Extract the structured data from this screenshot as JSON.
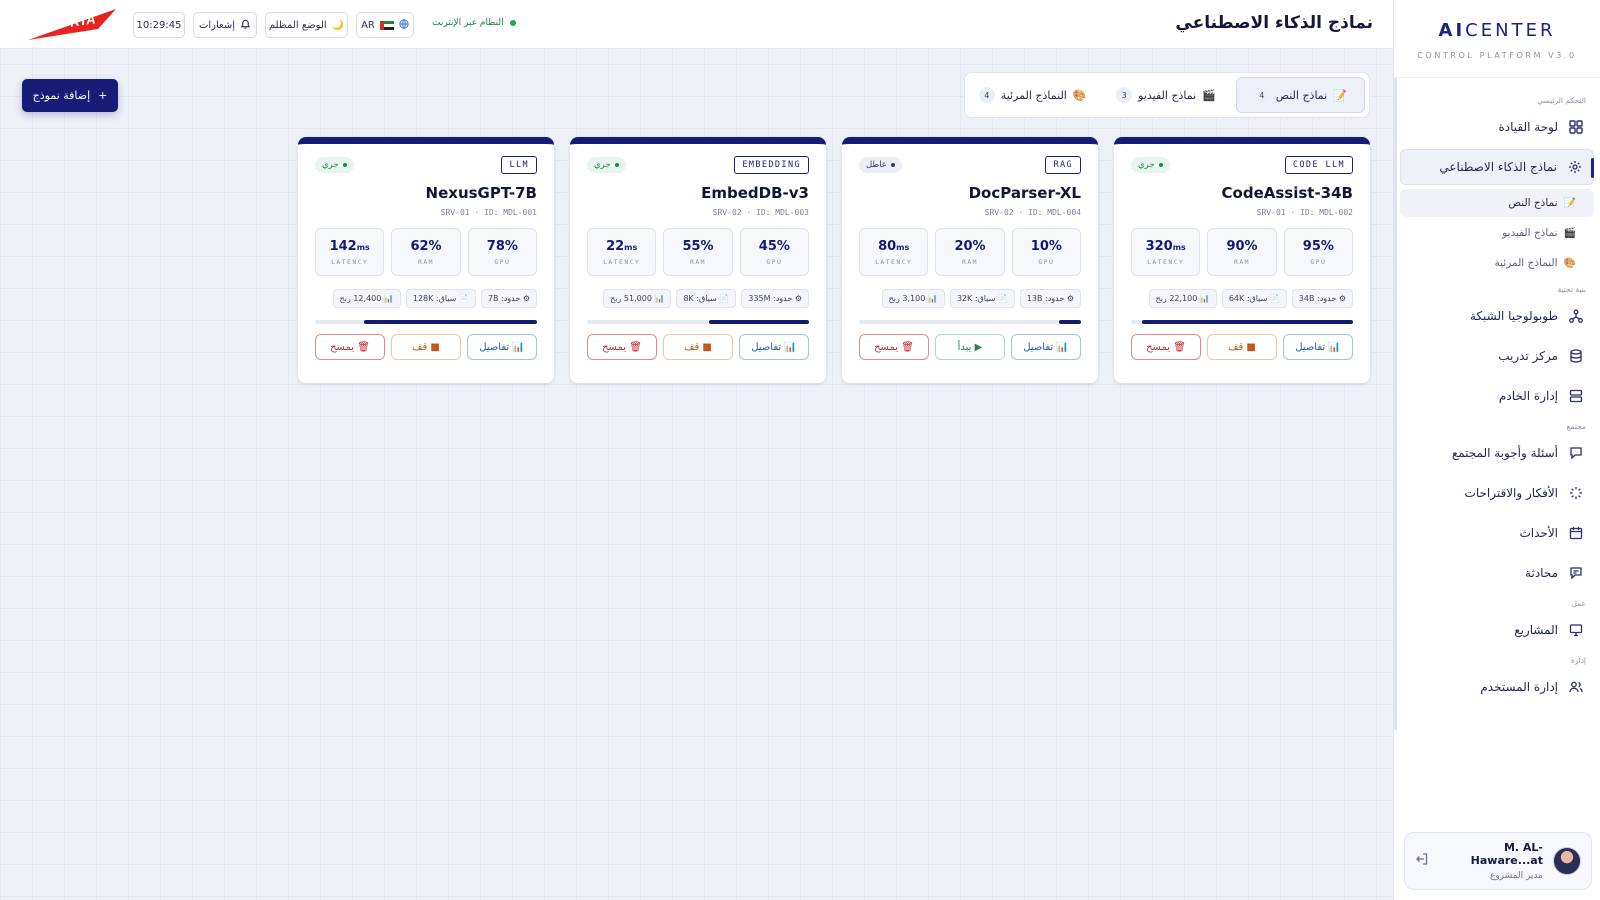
{
  "brand": {
    "title_bold": "AI",
    "title_rest": "CENTER",
    "subtitle": "CONTROL PLATFORM V3.0"
  },
  "sidebar": {
    "sections": [
      {
        "label": "التحكم الرئيسي"
      },
      {
        "label": "بنية تحتية"
      },
      {
        "label": "مجتمع"
      },
      {
        "label": "عمل"
      },
      {
        "label": "إدارة"
      }
    ],
    "items": [
      {
        "label": "لوحة القيادة",
        "icon": "grid-icon"
      },
      {
        "label": "نماذج الذكاء الاصطناعي",
        "icon": "sparkle-icon",
        "active": true
      },
      {
        "label": "طوبولوجيا الشبكة",
        "icon": "network-icon"
      },
      {
        "label": "مركز تدريب",
        "icon": "database-icon"
      },
      {
        "label": "إدارة الخادم",
        "icon": "server-icon"
      },
      {
        "label": "أسئلة وأجوبة المجتمع",
        "icon": "chat-icon"
      },
      {
        "label": "الأفكار والاقتراحات",
        "icon": "loader-icon"
      },
      {
        "label": "الأحداث",
        "icon": "calendar-icon"
      },
      {
        "label": "محادثة",
        "icon": "message-icon"
      },
      {
        "label": "المشاريع",
        "icon": "monitor-icon"
      },
      {
        "label": "إدارة المستخدم",
        "icon": "users-icon"
      }
    ],
    "sub_items": [
      {
        "label": "نماذج النص",
        "emoji": "📝",
        "active": true
      },
      {
        "label": "نماذج الفيديو",
        "emoji": "🎬"
      },
      {
        "label": "النماذج المرئية",
        "emoji": "🎨"
      }
    ],
    "user": {
      "name": "M. AL-Haware...at",
      "role": "مدير المشروع"
    }
  },
  "topbar": {
    "page_title": "نماذج الذكاء الاصطناعي",
    "status": "النظام عبر الإنترنت",
    "lang": "AR",
    "dark_mode": "الوضع المظلم",
    "dark_mode_emoji": "🌙",
    "notifications": "إشعارات",
    "clock": "10:29:45",
    "logo_text": "RTA"
  },
  "main": {
    "add_button": "إضافة نموذج",
    "tabs": [
      {
        "emoji": "📝",
        "label": "نماذج النص",
        "count": "4",
        "active": true
      },
      {
        "emoji": "🎬",
        "label": "نماذج الفيديو",
        "count": "3"
      },
      {
        "emoji": "🎨",
        "label": "النماذج المرئية",
        "count": "4"
      }
    ],
    "cards": [
      {
        "type": "CODE LLM",
        "status": "جري",
        "status_on": true,
        "name": "CodeAssist-34B",
        "meta": "SRV-01 · ID: MDL-002",
        "gpu": "95%",
        "ram": "90%",
        "latency_value": "320",
        "latency_unit": "ms",
        "chip_params": "⚙ حدود: 34B",
        "chip_context": "📄 سياق: 64K",
        "chip_calls": "📊 22,100 ربح",
        "progress": 0.95,
        "btn_details": "📊 تفاصيل",
        "btn_toggle": "■ قف",
        "btn_toggle_kind": "stop",
        "btn_delete": "🗑 يمسح"
      },
      {
        "type": "RAG",
        "status": "عاطل",
        "status_on": false,
        "name": "DocParser-XL",
        "meta": "SRV-02 · ID: MDL-004",
        "gpu": "10%",
        "ram": "20%",
        "latency_value": "80",
        "latency_unit": "ms",
        "chip_params": "⚙ حدود: 13B",
        "chip_context": "📄 سياق: 32K",
        "chip_calls": "📊 3,100 ربح",
        "progress": 0.1,
        "btn_details": "📊 تفاصيل",
        "btn_toggle": "▶ يبدأ",
        "btn_toggle_kind": "start",
        "btn_delete": "🗑 يمسح"
      },
      {
        "type": "EMBEDDING",
        "status": "جري",
        "status_on": true,
        "name": "EmbedDB-v3",
        "meta": "SRV-02 · ID: MDL-003",
        "gpu": "45%",
        "ram": "55%",
        "latency_value": "22",
        "latency_unit": "ms",
        "chip_params": "⚙ حدود: 335M",
        "chip_context": "📄 سياق: 8K",
        "chip_calls": "📊 51,000 ربح",
        "progress": 0.45,
        "btn_details": "📊 تفاصيل",
        "btn_toggle": "■ قف",
        "btn_toggle_kind": "stop",
        "btn_delete": "🗑 يمسح"
      },
      {
        "type": "LLM",
        "status": "جري",
        "status_on": true,
        "name": "NexusGPT-7B",
        "meta": "SRV-01 · ID: MDL-001",
        "gpu": "78%",
        "ram": "62%",
        "latency_value": "142",
        "latency_unit": "ms",
        "chip_params": "⚙ حدود: 7B",
        "chip_context": "📄 سياق: 128K",
        "chip_calls": "📊 12,400 ربح",
        "progress": 0.78,
        "btn_details": "📊 تفاصيل",
        "btn_toggle": "■ قف",
        "btn_toggle_kind": "stop",
        "btn_delete": "🗑 يمسح"
      }
    ],
    "metric_labels": {
      "gpu": "GPU",
      "ram": "RAM",
      "latency": "LATENCY"
    }
  },
  "colors": {
    "accent": "#141a78",
    "running": "#1b8a4b",
    "danger": "#c62828",
    "warning": "#c2571a"
  }
}
